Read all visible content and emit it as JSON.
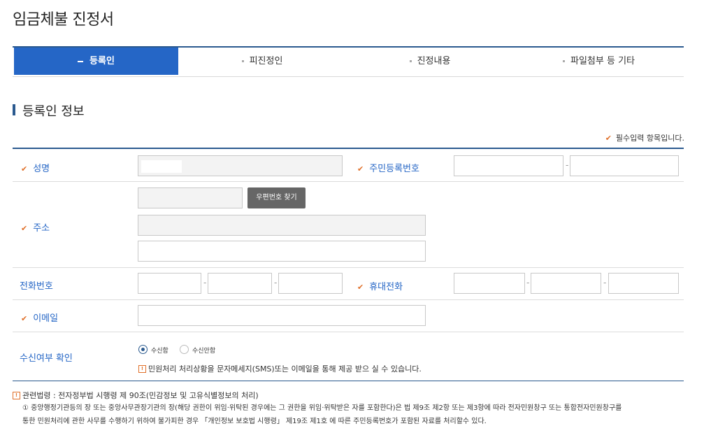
{
  "page": {
    "title": "임금체불 진정서"
  },
  "tabs": [
    {
      "label": "등록인",
      "active": true
    },
    {
      "label": "피진정인",
      "active": false
    },
    {
      "label": "진정내용",
      "active": false
    },
    {
      "label": "파일첨부 등 기타",
      "active": false
    }
  ],
  "section": {
    "title": "등록인 정보",
    "required_note": "필수입력 항목입니다."
  },
  "form": {
    "name_label": "성명",
    "name_value": "",
    "rrn_label": "주민등록번호",
    "rrn_first": "",
    "rrn_second": "",
    "address_label": "주소",
    "zipcode": "",
    "zip_button": "우편번호 찾기",
    "address1": "",
    "address2": "",
    "phone_label": "전화번호",
    "phone": [
      "",
      "",
      ""
    ],
    "mobile_label": "휴대전화",
    "mobile": [
      "",
      "",
      ""
    ],
    "email_label": "이메일",
    "email": "",
    "consent_label": "수신여부 확인",
    "consent_options": [
      {
        "label": "수신함",
        "selected": true
      },
      {
        "label": "수신안함",
        "selected": false
      }
    ],
    "consent_notice": "민원처리 처리상황을 문자메세지(SMS)또는 이메일을 통해 제공 받으 실 수 있습니다."
  },
  "legal": {
    "title": "관련법령 : 전자정부법 시행령 제 90조(민감정보 및 고유식별정보의 처리)",
    "line1": "① 중앙행정기관등의 장 또는 중앙사무관장기관의 장(해당 권한이 위임·위탁된 경우에는 그 권한을 위임·위탁받은 자를 포함한다)은 법 제9조 제2항 또는 제3항에 따라 전자민원창구 또는 통합전자민원창구를",
    "line2": "통한 민원처리에 관한 사무를 수행하기 위하여 불가피한 경우 「개인정보 보호법 시행령」 제19조 제1호 에 따른 주민등록번호가 포함된 자료를 처리할수 있다."
  },
  "colors": {
    "accent": "#2566c6",
    "navy": "#2b5a8f",
    "check": "#e0702a"
  }
}
